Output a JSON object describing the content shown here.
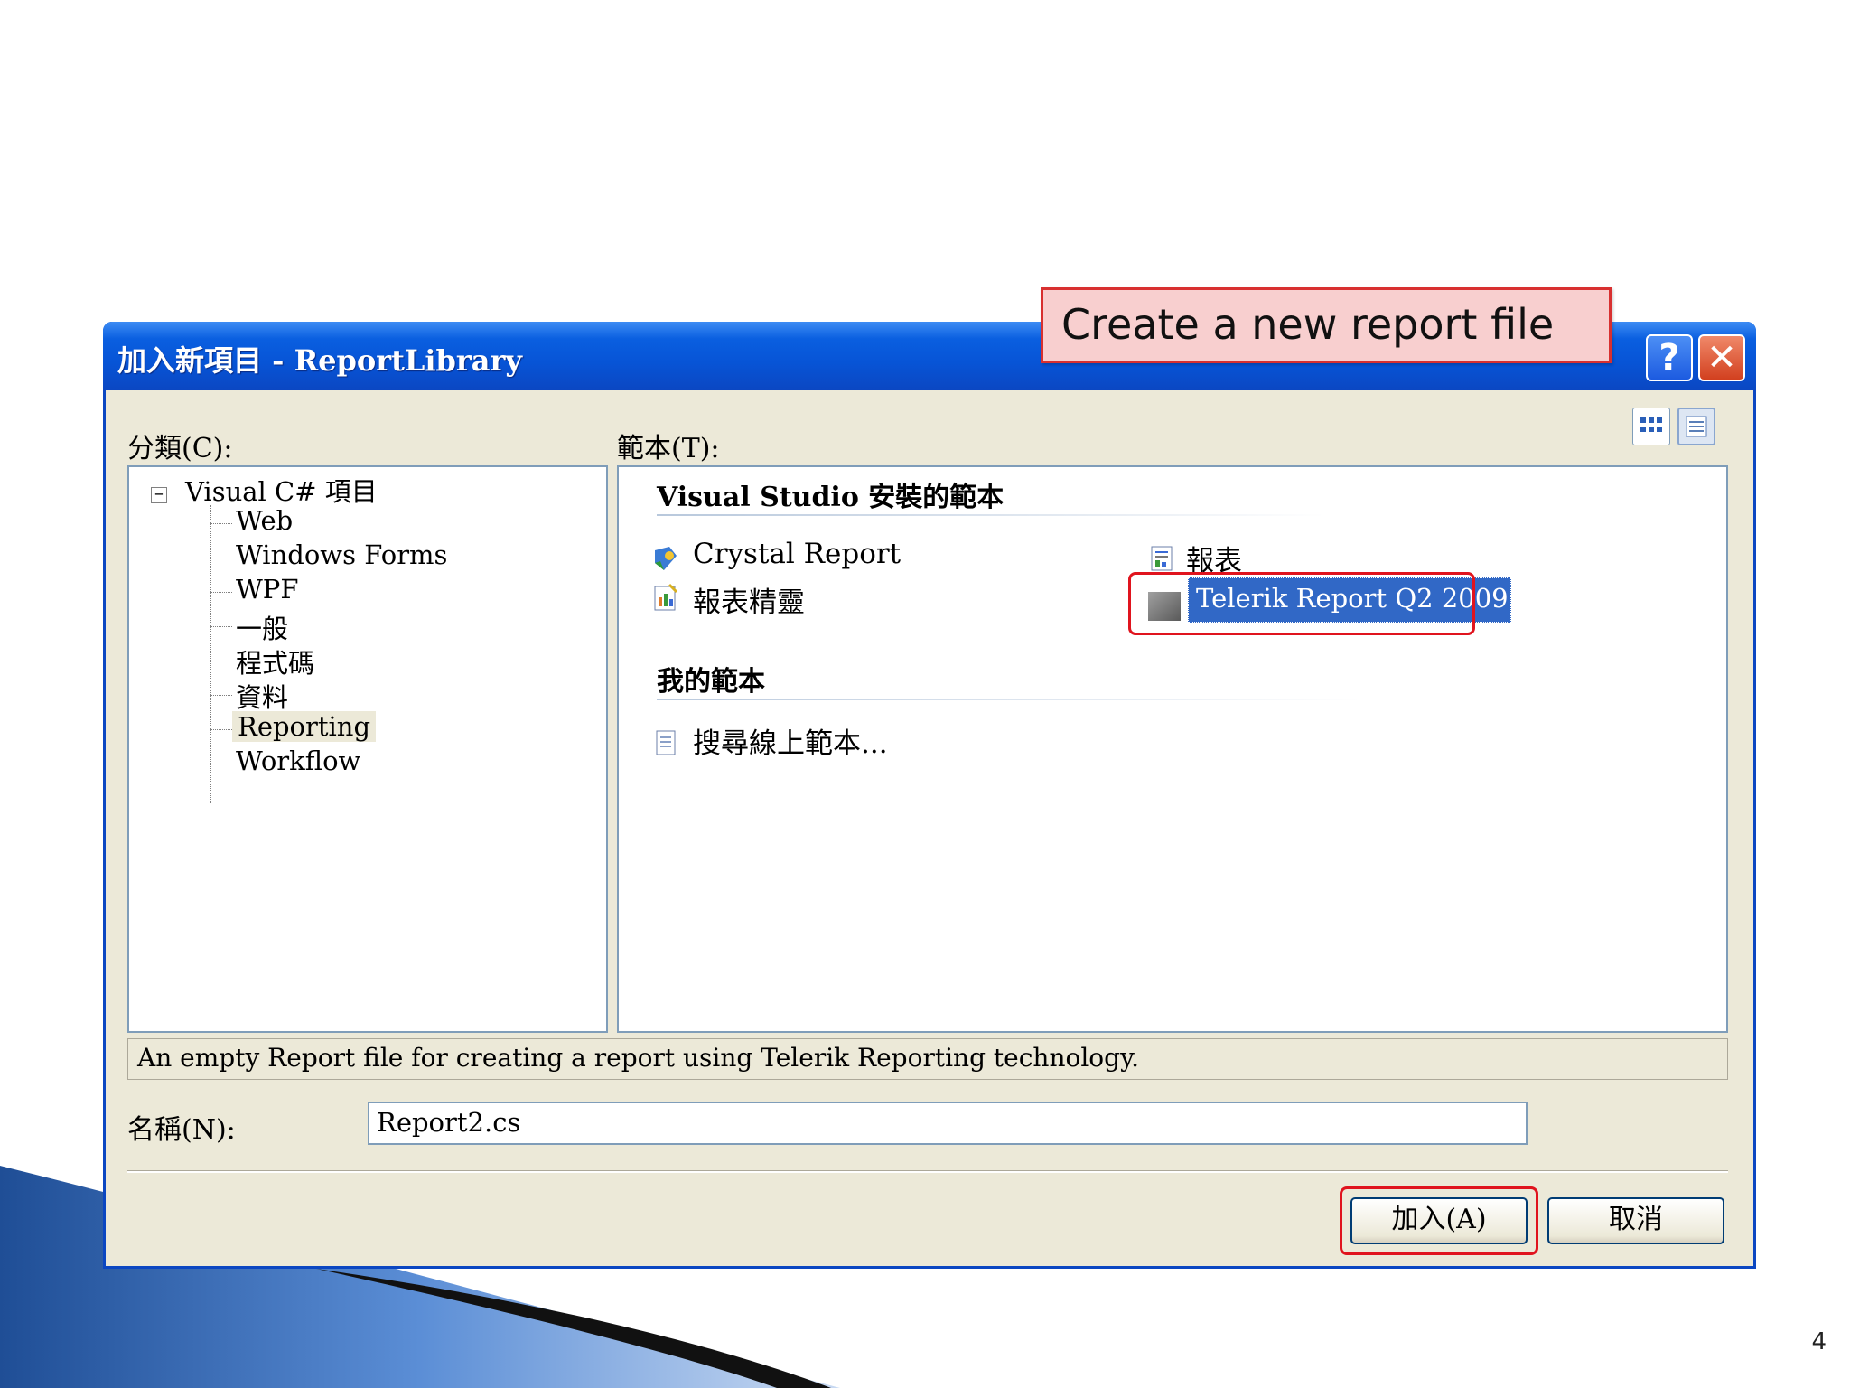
{
  "slide": {
    "page_number": "4"
  },
  "callout": {
    "text": "Create a new report file"
  },
  "dialog": {
    "title": "加入新項目 - ReportLibrary",
    "help_glyph": "?",
    "close_glyph": "✕",
    "categories_label": "分類(C):",
    "templates_label": "範本(T):",
    "categories": {
      "root": "Visual C# 項目",
      "expander_glyph": "−",
      "items": [
        "Web",
        "Windows Forms",
        "WPF",
        "一般",
        "程式碼",
        "資料",
        "Reporting",
        "Workflow"
      ]
    },
    "template_groups": {
      "installed_header": "Visual Studio 安裝的範本",
      "installed": [
        "Crystal Report",
        "報表精靈",
        "報表",
        "Telerik Report Q2 2009"
      ],
      "my_header": "我的範本",
      "my": [
        "搜尋線上範本..."
      ]
    },
    "description": "An empty Report file for creating a report using Telerik Reporting  technology.",
    "name_label": "名稱(N):",
    "name_value": "Report2.cs",
    "add_button": "加入(A)",
    "cancel_button": "取消"
  },
  "colors": {
    "titlebar": "#0b47c2",
    "highlight": "#e0141e",
    "callout_fill": "#f8cfcf",
    "selection": "#3168c6"
  }
}
